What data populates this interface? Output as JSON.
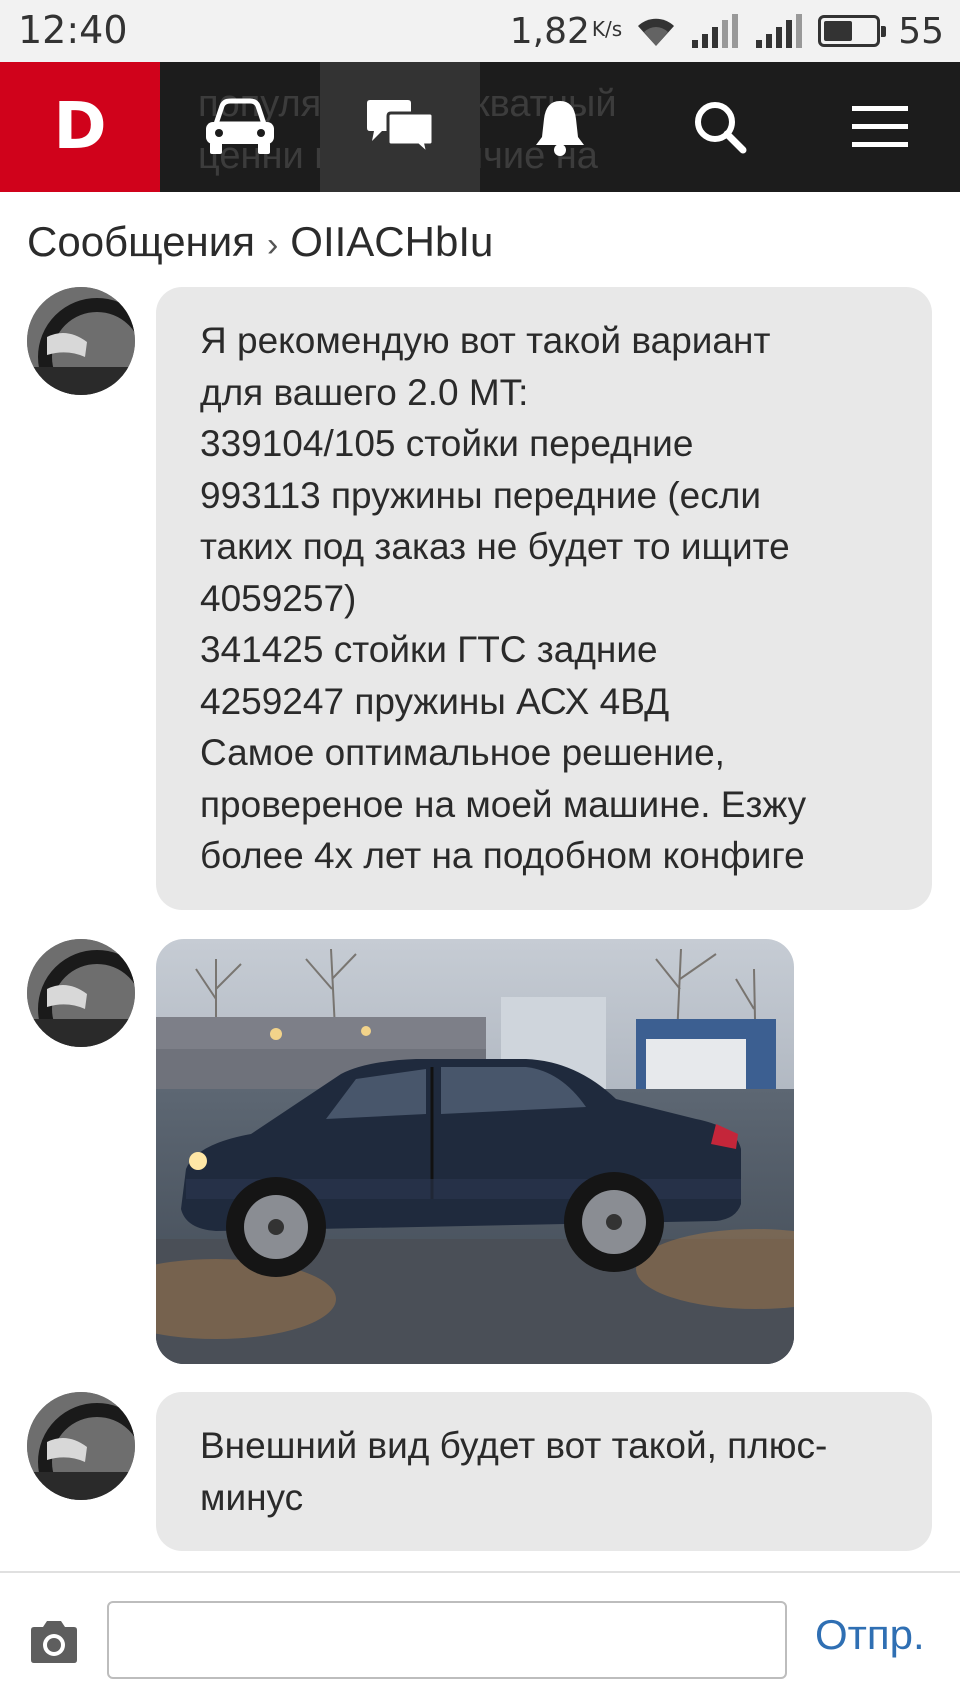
{
  "status_bar": {
    "time": "12:40",
    "speed": "1,82",
    "speed_unit": "K/s",
    "battery": "55",
    "battery_level": 0.55
  },
  "nav": {
    "logo": "D",
    "ghost_lines": [
      "популя         еют адекватный",
      "ценни        шое наличие на"
    ],
    "items": [
      "car-icon",
      "messages-icon",
      "bell-icon",
      "search-icon",
      "menu-icon"
    ],
    "active_item": "messages-icon"
  },
  "breadcrumb": {
    "root": "Сообщения",
    "separator": "›",
    "current": "OIIACHbIu"
  },
  "messages": [
    {
      "type": "text",
      "text": "Я рекомендую вот такой вариант\nдля вашего 2.0 MT:\n339104/105 стойки передние\n993113 пружины передние (если\nтаких под заказ не будет то ищите\n4059257)\n341425 стойки ГТС задние\n4259247 пружины АСХ 4ВД\nСамое оптимальное решение,\nпровереное на моей машине. Езжу\nболее 4х лет на подобном конфиге"
    },
    {
      "type": "image",
      "image": "car-photo"
    },
    {
      "type": "text",
      "text": "Внешний вид будет вот такой, плюс-\nминус"
    }
  ],
  "composer": {
    "value": "",
    "send_label": "Отпр."
  },
  "colors": {
    "brand": "#d0021b",
    "nav_bg": "#1c1c1c",
    "bubble_bg": "#e8e8e8",
    "send": "#2f6fb3"
  }
}
